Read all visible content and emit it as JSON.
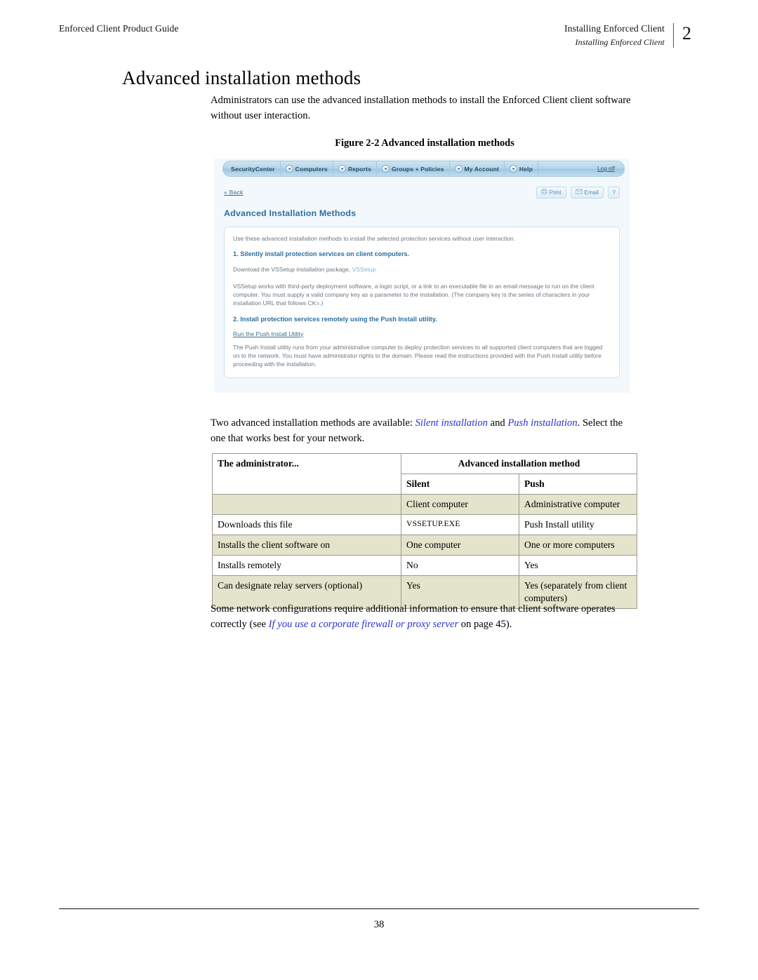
{
  "header": {
    "left_text": "Enforced Client Product Guide",
    "right_line1": "Installing Enforced Client",
    "right_line2": "Installing Enforced Client",
    "chapter_number": "2"
  },
  "title": "Advanced installation methods",
  "intro_paragraph": "Administrators can use the advanced installation methods to install the Enforced Client client software without user interaction.",
  "figure": {
    "caption": "Figure 2-2  Advanced installation methods",
    "app": {
      "nav_tabs": [
        {
          "label": "SecurityCenter",
          "has_caret": false
        },
        {
          "label": "Computers",
          "has_caret": true
        },
        {
          "label": "Reports",
          "has_caret": true
        },
        {
          "label": "Groups + Policies",
          "has_caret": true
        },
        {
          "label": "My Account",
          "has_caret": true
        },
        {
          "label": "Help",
          "has_caret": true
        }
      ],
      "logoff_label": "Log off",
      "back_label": "« Back",
      "tool_buttons": [
        {
          "label": "Print",
          "icon": "printer-icon"
        },
        {
          "label": "Email",
          "icon": "envelope-icon"
        },
        {
          "label": "?",
          "icon": "question-mark-icon"
        }
      ],
      "panel_heading": "Advanced Installation Methods",
      "intro_line": "Use these advanced installation methods to install the selected protection services without user interaction.",
      "step1_heading": "1. Silently install protection services on client computers.",
      "step1_download_prefix": "Download the VSSetup installation package, ",
      "step1_download_link": "VSSetup",
      "step1_body": "VSSetup works with third-party deployment software, a login script, or a link to an executable file in an email message to run on the client computer. You must supply a valid company key as a parameter to the installation. (The company key is the series of characters in your installation URL that follows CK=.)",
      "step2_heading": "2. Install protection services remotely using the Push Install utility.",
      "step2_link": "Run the Push Install Utility",
      "step2_body": "The Push Install utility runs from your administrative computer to deploy protection services to all supported client computers that are logged on to the network. You must have administrator rights to the domain. Please read the instructions provided with the Push Install utility before proceeding with the installation."
    }
  },
  "methods_paragraph": {
    "lead": "Two advanced installation methods are available: ",
    "xref_1": "Silent installation",
    "mid": " and ",
    "xref_2": "Push installation",
    "tail": ". Select the one that works best for your network."
  },
  "table": {
    "group_header": "Advanced installation method",
    "col_a_header": "The administrator...",
    "col_b_header": "Silent",
    "col_c_header": "Push",
    "rows": [
      {
        "label": "",
        "silent": "Client computer",
        "push": "Administrative computer",
        "shaded": true
      },
      {
        "label": "Downloads this file",
        "silent": "VSSETUP.EXE",
        "push": "Push Install utility",
        "shaded": false,
        "silent_mono": true
      },
      {
        "label": "Installs the client software on",
        "silent": "One computer",
        "push": "One or more computers",
        "shaded": true
      },
      {
        "label": "Installs remotely",
        "silent": "No",
        "push": "Yes",
        "shaded": false
      },
      {
        "label": "Can designate relay servers (optional)",
        "silent": "Yes",
        "push": "Yes (separately from client computers)",
        "shaded": true
      }
    ]
  },
  "closing_paragraph": {
    "lead": "Some network configurations require additional information to ensure that client software operates correctly (see ",
    "xref": "If you use a corporate firewall or proxy server",
    "tail_prefix": " on page ",
    "page_ref": "45",
    "tail": ")."
  },
  "footer": {
    "page_number": "38"
  },
  "colors": {
    "xref_blue": "#2633d6",
    "app_heading_blue": "#2d6e9e",
    "table_shade": "#e4e3cb",
    "table_border": "#9a9a8c"
  }
}
